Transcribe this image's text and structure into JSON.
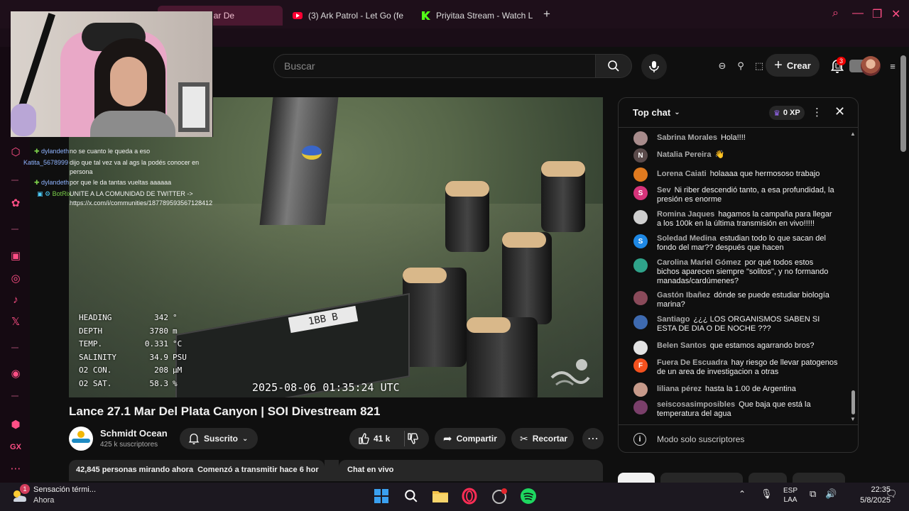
{
  "browser": {
    "tabs": [
      {
        "label": "lance 27.1 Mar De",
        "active": true
      },
      {
        "label": "(3) Ark Patrol - Let Go (fe",
        "active": false
      },
      {
        "label": "Priyitaa Stream - Watch L",
        "active": false
      }
    ],
    "new_tab_label": "+",
    "accent": "#ff4f86"
  },
  "header": {
    "search_placeholder": "Buscar",
    "create_label": "Crear",
    "notification_count": "3"
  },
  "video": {
    "title": "Lance 27.1 Mar Del Plata Canyon | SOI Divestream 821",
    "timestamp": "2025-08-06 01:35:24 UTC",
    "tray_label": "1BB B",
    "hud": [
      {
        "key": "HEADING",
        "value": "342",
        "unit": "°"
      },
      {
        "key": "DEPTH",
        "value": "3780",
        "unit": "m"
      },
      {
        "key": "TEMP.",
        "value": "0.331",
        "unit": "°C"
      },
      {
        "key": "SALINITY",
        "value": "34.9",
        "unit": "PSU"
      },
      {
        "key": "O2 CON.",
        "value": "208",
        "unit": "μM"
      },
      {
        "key": "O2 SAT.",
        "value": "58.3",
        "unit": "%"
      }
    ]
  },
  "stream_chat_overlay": [
    {
      "user": "dylandeth",
      "msg": "no se cuanto le queda a eso"
    },
    {
      "user": "Katita_5678999",
      "msg": "dijo que tal vez va al ags la podés conocer en"
    },
    {
      "user": "",
      "msg": "persona"
    },
    {
      "user": "dylandeth",
      "msg": "por que le da tantas vueltas aaaaaa"
    },
    {
      "user": "BotRix",
      "msg": "UNITE A LA COMUNIDAD DE TWITTER ->"
    },
    {
      "user": "",
      "msg": "https://x.com/i/communities/187789593567128412"
    }
  ],
  "channel": {
    "name": "Schmidt Ocean",
    "subscribers": "425 k suscriptores",
    "subscribed_label": "Suscrito",
    "likes": "41 k",
    "share_label": "Compartir",
    "clip_label": "Recortar"
  },
  "description": {
    "viewers": "42,845 personas mirando ahora",
    "started": "Comenzó a transmitir hace 6 hor"
  },
  "chat_live_label": "Chat en vivo",
  "live_chat": {
    "mode_label": "Top chat",
    "xp_label": "0 XP",
    "footer_label": "Modo solo suscriptores",
    "messages": [
      {
        "author": "Sabrina Morales",
        "text": "Hola!!!!",
        "avatar": "",
        "color": "#a78b8b"
      },
      {
        "author": "Natalia Pereira",
        "text": "👋",
        "avatar": "N",
        "color": "#5b4b4b"
      },
      {
        "author": "Lorena Caiati",
        "text": "holaaaa que hermososo trabajo",
        "avatar": "",
        "color": "#e07a1f"
      },
      {
        "author": "Sev",
        "text": "Ni riber descendió tanto, a esa profundidad, la presión es enorme",
        "avatar": "S",
        "color": "#d6337a"
      },
      {
        "author": "Romina Jaques",
        "text": "hagamos la campaña para llegar a los 100k en la última transmisión en vivo!!!!!",
        "avatar": "",
        "color": "#cfcfcf"
      },
      {
        "author": "Soledad Medina",
        "text": "estudian todo lo que sacan del fondo del mar?? después que hacen",
        "avatar": "S",
        "color": "#1e88e5"
      },
      {
        "author": "Carolina Mariel Gómez",
        "text": "por qué todos estos bichos aparecen siempre \"solitos\", y no formando manadas/cardúmenes?",
        "avatar": "",
        "color": "#2fa38a"
      },
      {
        "author": "Gastón Ibañez",
        "text": "dónde se puede estudiar biología marina?",
        "avatar": "",
        "color": "#8a4a5a"
      },
      {
        "author": "Santiago",
        "text": "¿¿¿ LOS ORGANISMOS SABEN SI ESTA DE DIA O DE NOCHE ???",
        "avatar": "",
        "color": "#3e6ab0"
      },
      {
        "author": "Belen Santos",
        "text": "que estamos agarrando bros?",
        "avatar": "",
        "color": "#e3e3e3"
      },
      {
        "author": "Fuera De Escuadra",
        "text": "hay riesgo de llevar patogenos de un area de investigacion a otras",
        "avatar": "F",
        "color": "#f4511e"
      },
      {
        "author": "liliana pérez",
        "text": "hasta la 1.00 de Argentina",
        "avatar": "",
        "color": "#c79a8a"
      },
      {
        "author": "seiscosasimposibles",
        "text": "Que baja que está la temperatura del agua",
        "avatar": "",
        "color": "#7a3f6a"
      }
    ]
  },
  "taskbar": {
    "news_title": "Sensación térmi...",
    "news_sub": "Ahora",
    "news_badge": "1",
    "lang": "ESP",
    "layout": "LAA",
    "time": "22:35",
    "date": "5/8/2025"
  }
}
